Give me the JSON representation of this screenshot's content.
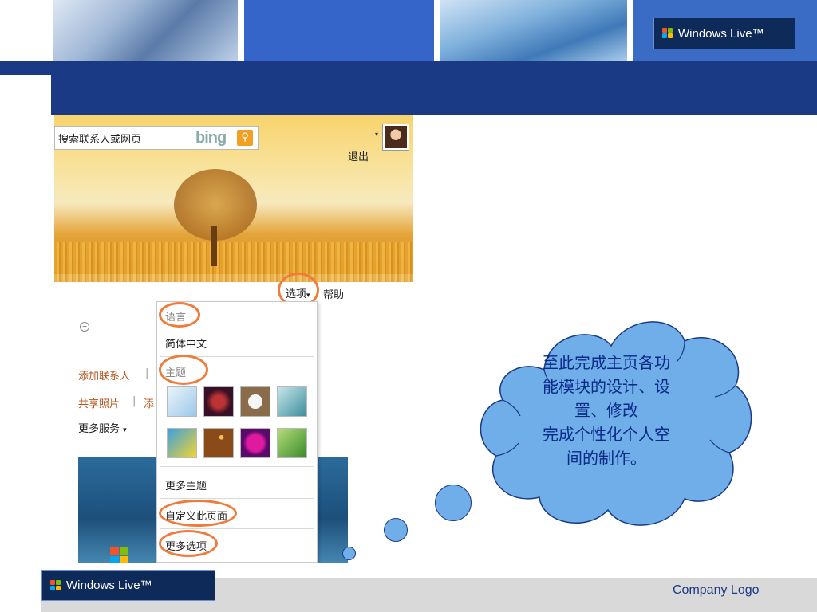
{
  "header": {
    "brand_label": "Windows Live™"
  },
  "screenshot": {
    "search_placeholder": "搜索联系人或网页",
    "search_engine": "bing",
    "exit_label": "退出",
    "options_label": "选项",
    "options_arrow": "▾",
    "help_label": "帮助",
    "left_links": {
      "add_contact": "添加联系人",
      "separator": "|",
      "share_photos": "共享照片",
      "add_partial": "添",
      "more_services": "更多服务",
      "more_arrow": "▾"
    },
    "menu": {
      "language_header": "语言",
      "language_option": "简体中文",
      "theme_header": "主题",
      "more_themes": "更多主题",
      "customize_page": "自定义此页面",
      "more_options": "更多选项"
    }
  },
  "callout": {
    "line1": "至此完成主页各功",
    "line2": "能模块的设计、设",
    "line3": "置、修改",
    "line4": "完成个性化个人空",
    "line5": "间的制作。"
  },
  "footer": {
    "brand_label": "Windows Live™",
    "company_logo": "Company Logo"
  },
  "colors": {
    "dark_blue": "#1b3a86",
    "accent_orange": "#f07b3a",
    "cloud_fill": "#6faee8",
    "cloud_text": "#0a2a88"
  }
}
